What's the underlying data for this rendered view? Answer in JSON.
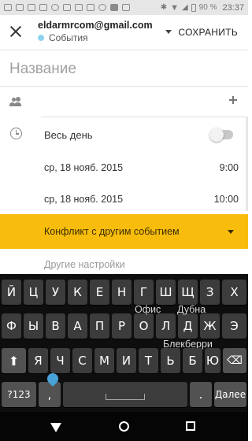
{
  "status_bar": {
    "battery": "90 %",
    "time": "23:37"
  },
  "toolbar": {
    "account": "eldarmrcom@gmail.com",
    "calendar": "События",
    "calendar_color": "#8fd3f0",
    "save_label": "СОХРАНИТЬ"
  },
  "event": {
    "title_placeholder": "Название",
    "all_day_label": "Весь день",
    "all_day_on": false,
    "start_date": "ср, 18 нояб. 2015",
    "start_time": "9:00",
    "end_date": "ср, 18 нояб. 2015",
    "end_time": "10:00",
    "conflict_text": "Конфликт с другим событием",
    "conflict_color": "#f8bc0c",
    "more_settings": "Другие настройки"
  },
  "keyboard": {
    "row1": [
      "Й",
      "Ц",
      "У",
      "К",
      "Е",
      "Н",
      "Г",
      "Ш",
      "Щ",
      "З",
      "Х"
    ],
    "row2": [
      "Ф",
      "Ы",
      "В",
      "А",
      "П",
      "Р",
      "О",
      "Л",
      "Д",
      "Ж",
      "Э"
    ],
    "row3": [
      "Я",
      "Ч",
      "С",
      "М",
      "И",
      "Т",
      "Ь",
      "Б",
      "Ю"
    ],
    "suggestions": [
      "Офис",
      "Дубна",
      "Блекберри"
    ],
    "symbols_key": "?123",
    "comma_key": ",",
    "period_key": ".",
    "enter_key": "Далее",
    "shift_icon": "shift-icon",
    "backspace_icon": "backspace-icon"
  }
}
